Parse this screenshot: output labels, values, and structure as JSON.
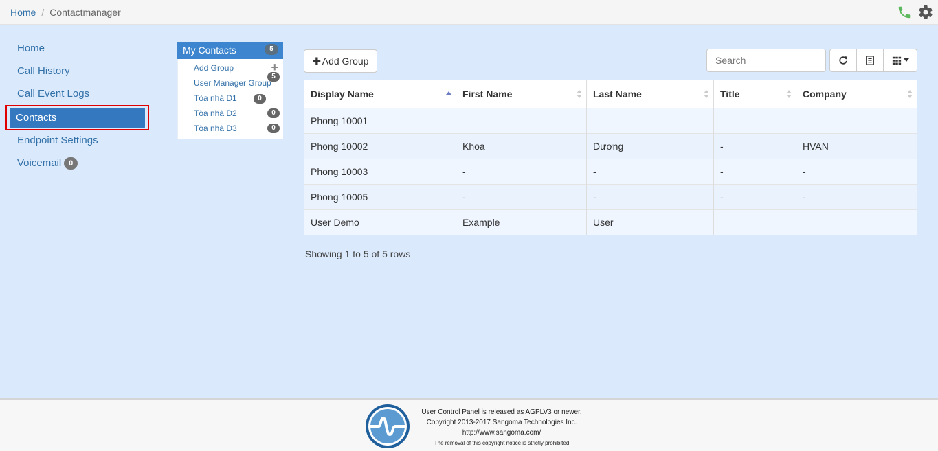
{
  "breadcrumb": {
    "home": "Home",
    "current": "Contactmanager"
  },
  "top_icons": [
    "phone-icon",
    "gear-icon"
  ],
  "nav": {
    "items": [
      {
        "label": "Home"
      },
      {
        "label": "Call History"
      },
      {
        "label": "Call Event Logs"
      },
      {
        "label": "Contacts",
        "active": true
      },
      {
        "label": "Endpoint Settings"
      },
      {
        "label": "Voicemail",
        "badge": "0"
      }
    ]
  },
  "groups": {
    "title": "My Contacts",
    "count": "5",
    "items": [
      {
        "label": "Add Group",
        "icon": "plus-icon"
      },
      {
        "label": "User Manager Group",
        "badge": "5"
      },
      {
        "label": "Tòa nhà D1",
        "badge": "0"
      },
      {
        "label": "Tòa nhà D2",
        "badge": "0"
      },
      {
        "label": "Tòa nhà D3",
        "badge": "0"
      }
    ]
  },
  "toolbar": {
    "add_group_label": "Add Group",
    "search_placeholder": "Search"
  },
  "table": {
    "columns": [
      "Display Name",
      "First Name",
      "Last Name",
      "Title",
      "Company"
    ],
    "rows": [
      [
        "Phong 10001",
        "",
        "",
        "",
        ""
      ],
      [
        "Phong 10002",
        "Khoa",
        "Dương",
        "-",
        "HVAN"
      ],
      [
        "Phong 10003",
        "-",
        "-",
        "-",
        "-"
      ],
      [
        "Phong 10005",
        "-",
        "-",
        "-",
        "-"
      ],
      [
        "User Demo",
        "Example",
        "User",
        "",
        ""
      ]
    ],
    "sorted_column": "Display Name",
    "showing": "Showing 1 to 5 of 5 rows"
  },
  "footer": {
    "line1": "User Control Panel is released as AGPLV3 or newer.",
    "line2": "Copyright 2013-2017 Sangoma Technologies Inc.",
    "line3": "http://www.sangoma.com/",
    "line4": "The removal of this copyright notice is strictly prohibited"
  },
  "colors": {
    "accent": "#3478bf",
    "highlight_border": "#e00000",
    "phone": "#5cb85c"
  }
}
